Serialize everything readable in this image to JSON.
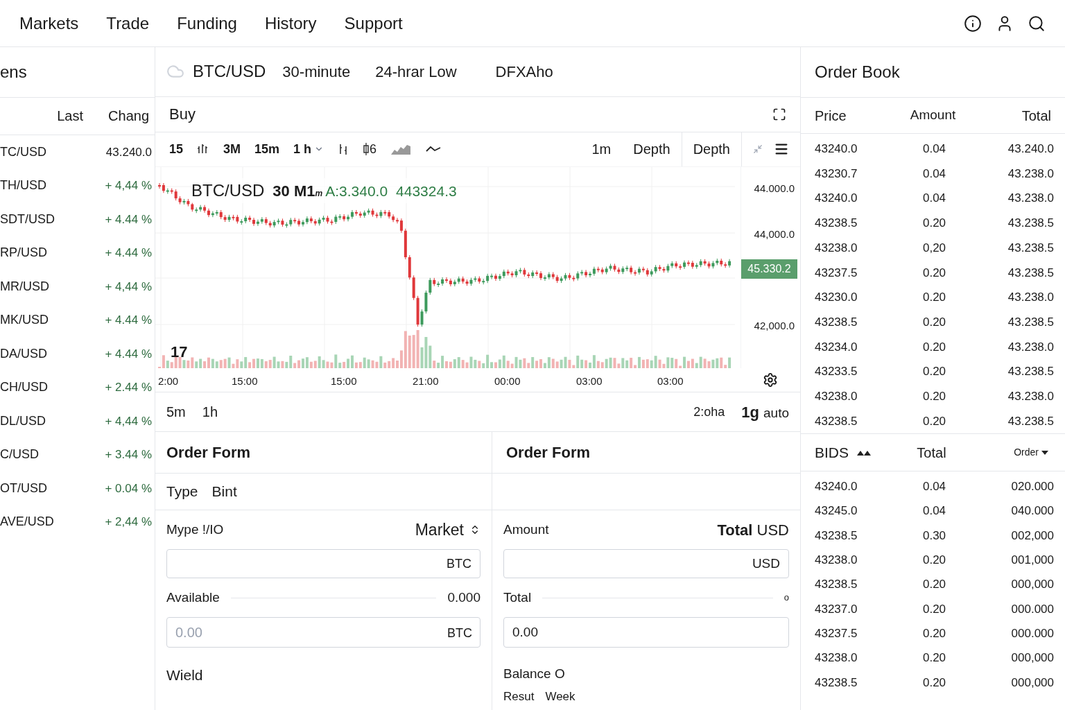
{
  "nav": {
    "items": [
      "Markets",
      "Trade",
      "Funding",
      "History",
      "Support"
    ]
  },
  "markets": {
    "title": "ens",
    "columns": [
      "Last",
      "Chang"
    ],
    "rows": [
      {
        "pair": "TC/USD",
        "value": "43.240.0",
        "kind": "price"
      },
      {
        "pair": "TH/USD",
        "value": "+ 4,44 %",
        "kind": "change"
      },
      {
        "pair": "SDT/USD",
        "value": "+ 4.44 %",
        "kind": "change"
      },
      {
        "pair": "RP/USD",
        "value": "+ 4.44 %",
        "kind": "change"
      },
      {
        "pair": "MR/USD",
        "value": "+ 4,44 %",
        "kind": "change"
      },
      {
        "pair": "MK/USD",
        "value": "+ 4.44 %",
        "kind": "change"
      },
      {
        "pair": "DA/USD",
        "value": "+ 4.44 %",
        "kind": "change"
      },
      {
        "pair": "CH/USD",
        "value": "+ 2.44 %",
        "kind": "change"
      },
      {
        "pair": "DL/USD",
        "value": "+ 4,44 %",
        "kind": "change"
      },
      {
        "pair": "C/USD",
        "value": "+ 3.44 %",
        "kind": "change"
      },
      {
        "pair": "OT/USD",
        "value": "+ 0.04 %",
        "kind": "change"
      },
      {
        "pair": "AVE/USD",
        "value": "+ 2,44 %",
        "kind": "change"
      }
    ]
  },
  "chart_header": {
    "pair": "BTC/USD",
    "interval": "30-minute",
    "stat": "24-hrar Low",
    "exchange": "DFXAho"
  },
  "side_bar": {
    "title": "Buy"
  },
  "toolbar": {
    "items": [
      {
        "kind": "text",
        "label": "15"
      },
      {
        "kind": "bars"
      },
      {
        "kind": "text",
        "label": "3M"
      },
      {
        "kind": "text",
        "label": "15m"
      },
      {
        "kind": "dropdown",
        "label": "1 h"
      },
      {
        "kind": "ticks"
      },
      {
        "kind": "candle",
        "label": "6"
      },
      {
        "kind": "area"
      },
      {
        "kind": "line"
      }
    ],
    "right": [
      {
        "label": "1m",
        "divider": false
      },
      {
        "label": "Depth",
        "divider": false
      },
      {
        "label": "Depth",
        "divider": true
      }
    ]
  },
  "chart": {
    "pair": "BTC/USD",
    "interval": "30 M1",
    "interval_suffix": "m",
    "open": "A:3.340.0",
    "close": "443324.3",
    "logo": "17",
    "y_labels": [
      "44.000.0",
      "44,000.0",
      "42,000.0"
    ],
    "price_tag": "45.330.2",
    "x_labels": [
      "2:00",
      "15:00",
      "15:00",
      "21:00",
      "00:00",
      "03:00",
      "03:00"
    ]
  },
  "range_bar": {
    "left": [
      "5m",
      "1h"
    ],
    "zone": "2:oha",
    "scale": "1g",
    "mode": "auto"
  },
  "order_forms": [
    {
      "title": "Order Form",
      "type_label": "Type",
      "type_value": "Bint",
      "field_label": "Mype !/IO",
      "field_value": "Market",
      "input_suffix": "BTC",
      "info_label": "Available",
      "info_value": "0.000",
      "second_placeholder": "0.00",
      "second_suffix": "BTC",
      "footer": "Wield"
    },
    {
      "title": "Order Form",
      "field_label": "Amount",
      "field_value_bold": "Total",
      "field_value": "USD",
      "input_suffix": "USD",
      "info_label": "Total",
      "info_value": "o",
      "second_value": "0.00",
      "balance": "Balance O",
      "links": [
        "Resut",
        "Week"
      ]
    }
  ],
  "order_book": {
    "title": "Order Book",
    "columns": [
      "Price",
      "Amount",
      "Total"
    ],
    "asks": [
      [
        "43240.0",
        "0.04",
        "43.240.0"
      ],
      [
        "43230.7",
        "0.04",
        "43.238.0"
      ],
      [
        "43240.0",
        "0.04",
        "43.238.0"
      ],
      [
        "43238.5",
        "0.20",
        "43.238.5"
      ],
      [
        "43238.0",
        "0,20",
        "43.238.5"
      ],
      [
        "43237.5",
        "0.20",
        "43.238.5"
      ],
      [
        "43230.0",
        "0.20",
        "43.238.0"
      ],
      [
        "43238.5",
        "0.20",
        "43.238.5"
      ],
      [
        "43234.0",
        "0.20",
        "43.238.0"
      ],
      [
        "43233.5",
        "0.20",
        "43.238.5"
      ],
      [
        "43238.0",
        "0.20",
        "43.238.0"
      ],
      [
        "43238.5",
        "0.20",
        "43.238.5"
      ]
    ],
    "bids_header": {
      "title": "BIDS",
      "total": "Total",
      "order": "Order"
    },
    "bids": [
      [
        "43240.0",
        "0.04",
        "020.000"
      ],
      [
        "43245.0",
        "0.04",
        "040.000"
      ],
      [
        "43238.5",
        "0.30",
        "002,000"
      ],
      [
        "43238.0",
        "0.20",
        "001,000"
      ],
      [
        "43238.5",
        "0.20",
        "000,000"
      ],
      [
        "43237.0",
        "0.20",
        "000.000"
      ],
      [
        "43237.5",
        "0.20",
        "000.000"
      ],
      [
        "43238.0",
        "0.20",
        "000,000"
      ],
      [
        "43238.5",
        "0.20",
        "000,000"
      ]
    ]
  }
}
